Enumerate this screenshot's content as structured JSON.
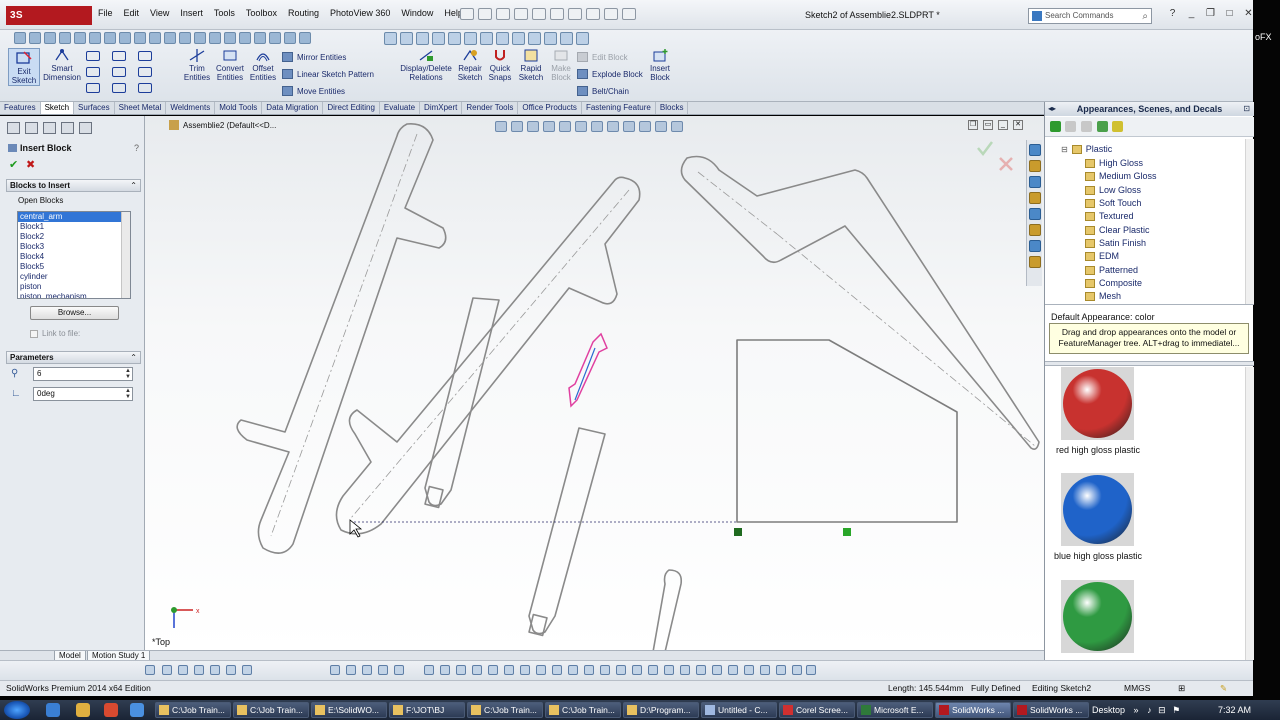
{
  "app": {
    "logo": "3S SOLIDWORKS",
    "document_title": "Sketch2 of Assemblie2.SLDPRT *",
    "menu": [
      "File",
      "Edit",
      "View",
      "Insert",
      "Tools",
      "Toolbox",
      "Routing",
      "PhotoView 360",
      "Window",
      "Help"
    ],
    "search_placeholder": "Search Commands",
    "right_strip_text": "oFX"
  },
  "ribbon": {
    "exit_sketch": "Exit\nSketch",
    "smart_dimension": "Smart\nDimension",
    "trim_entities": "Trim\nEntities",
    "convert_entities": "Convert\nEntities",
    "offset_entities": "Offset\nEntities",
    "mirror_entities": "Mirror Entities",
    "linear_sketch_pattern": "Linear Sketch Pattern",
    "move_entities": "Move Entities",
    "display_delete_relations": "Display/Delete\nRelations",
    "repair_sketch": "Repair\nSketch",
    "quick_snaps": "Quick\nSnaps",
    "rapid_sketch": "Rapid\nSketch",
    "make_block": "Make\nBlock",
    "edit_block": "Edit Block",
    "explode_block": "Explode Block",
    "belt_chain": "Belt/Chain",
    "insert_block": "Insert\nBlock"
  },
  "tabs": [
    "Features",
    "Sketch",
    "Surfaces",
    "Sheet Metal",
    "Weldments",
    "Mold Tools",
    "Data Migration",
    "Direct Editing",
    "Evaluate",
    "DimXpert",
    "Render Tools",
    "Office Products",
    "Fastening Feature",
    "Blocks"
  ],
  "property_manager": {
    "title": "Insert Block",
    "help": "?",
    "blocks_to_insert": "Blocks to Insert",
    "open_blocks": "Open Blocks",
    "blocks": [
      "central_arm",
      "Block1",
      "Block2",
      "Block3",
      "Block4",
      "Block5",
      "cylinder",
      "piston",
      "piston_mechanism"
    ],
    "browse": "Browse...",
    "link_to_file": "Link to file:",
    "parameters": "Parameters",
    "scale_value": "6",
    "angle_value": "0deg"
  },
  "canvas": {
    "breadcrumb": "Assemblie2  (Default<<D...",
    "view_orientation": "*Top"
  },
  "task_pane": {
    "title": "Appearances, Scenes, and Decals",
    "tree_root": "Plastic",
    "tree_items": [
      "High Gloss",
      "Medium Gloss",
      "Low Gloss",
      "Soft Touch",
      "Textured",
      "Clear Plastic",
      "Satin Finish",
      "EDM",
      "Patterned",
      "Composite",
      "Mesh"
    ],
    "default_appearance": "Default Appearance: color",
    "tooltip": "Drag and drop appearances onto the model or FeatureManager tree.  ALT+drag to immediatel...",
    "swatches": [
      {
        "label": "red high gloss plastic",
        "color": "#c8322f"
      },
      {
        "label": "blue high gloss plastic",
        "color": "#1f63c9"
      },
      {
        "label": "",
        "color": "#2f9a42"
      }
    ]
  },
  "bottom_tabs": [
    "Model",
    "Motion Study 1"
  ],
  "status": {
    "edition": "SolidWorks Premium 2014 x64 Edition",
    "length": "Length: 145.544mm",
    "defined": "Fully Defined",
    "editing": "Editing Sketch2",
    "units": "MMGS"
  },
  "taskbar": {
    "items": [
      "C:\\Job Train...",
      "C:\\Job Train...",
      "E:\\SolidWO...",
      "F:\\JOT\\BJ",
      "C:\\Job Train...",
      "C:\\Job Train...",
      "D:\\Program...",
      "Untitled - C...",
      "Corel Scree...",
      "Microsoft E...",
      "SolidWorks ...",
      "SolidWorks ..."
    ],
    "desktop": "Desktop",
    "time": "7:32 AM"
  }
}
